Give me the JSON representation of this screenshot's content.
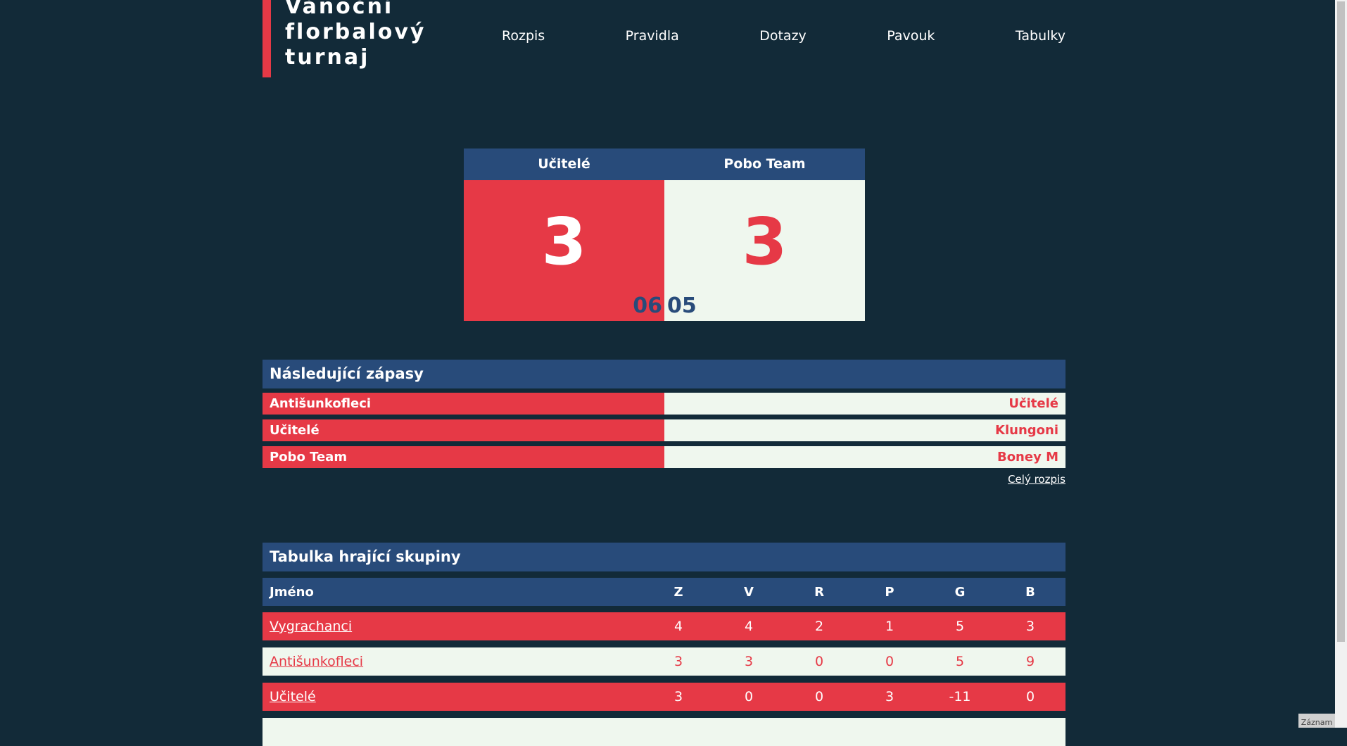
{
  "header": {
    "title_lines": [
      "Vánoční",
      "florbalový",
      "turnaj"
    ],
    "nav": [
      "Rozpis",
      "Pravidla",
      "Dotazy",
      "Pavouk",
      "Tabulky"
    ]
  },
  "scoreboard": {
    "home_team": "Učitelé",
    "away_team": "Pobo Team",
    "home_score": "3",
    "away_score": "3",
    "timer_minutes": "06",
    "timer_seconds": "05"
  },
  "next_matches": {
    "title": "Následující zápasy",
    "matches": [
      {
        "home": "Antišunkofleci",
        "away": "Učitelé"
      },
      {
        "home": "Učitelé",
        "away": "Klungoni"
      },
      {
        "home": "Pobo Team",
        "away": "Boney M"
      }
    ],
    "full_schedule_link": "Celý rozpis"
  },
  "group_table": {
    "title": "Tabulka hrající skupiny",
    "columns": [
      "Jméno",
      "Z",
      "V",
      "R",
      "P",
      "G",
      "B"
    ],
    "rows": [
      [
        "Vygrachanci",
        "4",
        "4",
        "2",
        "1",
        "5",
        "3"
      ],
      [
        "Antišunkofleci",
        "3",
        "3",
        "0",
        "0",
        "5",
        "9"
      ],
      [
        "Učitelé",
        "3",
        "0",
        "0",
        "3",
        "-11",
        "0"
      ]
    ]
  },
  "footer_badge": "Záznam",
  "colors": {
    "background": "#122a38",
    "red": "#e63946",
    "navy": "#284b7a",
    "light": "#eff7ee"
  }
}
